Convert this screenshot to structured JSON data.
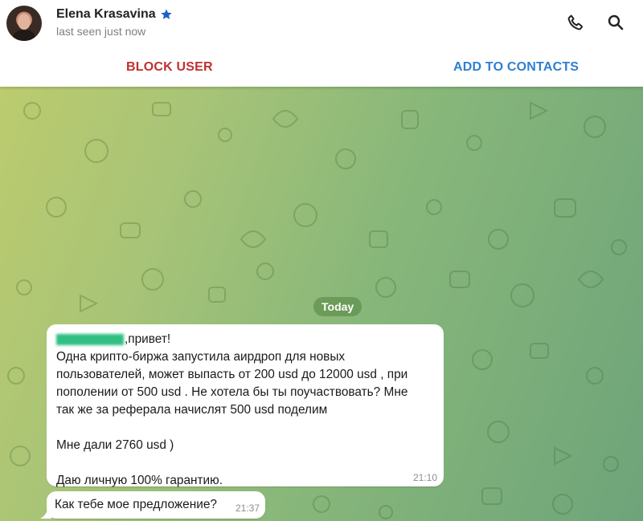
{
  "header": {
    "name": "Elena Krasavina",
    "status": "last seen just now",
    "icons": [
      "star-icon",
      "phone-icon",
      "search-icon"
    ]
  },
  "actions": {
    "block_label": "BLOCK USER",
    "add_label": "ADD TO CONTACTS"
  },
  "colors": {
    "block": "#c0302f",
    "add": "#2f7fcf",
    "star": "#1e5fc7"
  },
  "chat": {
    "date_label": "Today",
    "messages": [
      {
        "lines": [
          ",привет!",
          "Одна крипто-биржа запустила аирдроп для новых",
          "пользователей, может выпасть от 200 usd до 12000 usd  , при",
          "пополении от 500 usd . Не хотела бы ты поучаствовать? Мне",
          "так же за реферала начислят 500 usd поделим",
          "",
          "Мне дали 2760 usd )",
          "",
          "Даю личную 100% гарантию."
        ],
        "time": "21:10"
      },
      {
        "text": "Как тебе мое предложение?",
        "time": "21:37"
      }
    ]
  }
}
